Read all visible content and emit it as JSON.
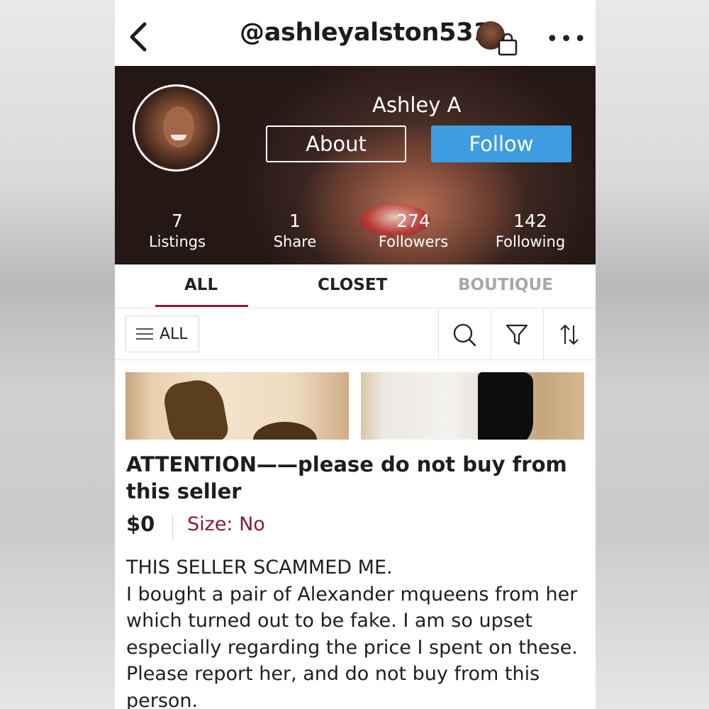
{
  "header": {
    "username": "@ashleyalston531"
  },
  "profile": {
    "display_name": "Ashley A",
    "about_label": "About",
    "follow_label": "Follow",
    "accent_color": "#3d9de0"
  },
  "stats": [
    {
      "value": "7",
      "label": "Listings"
    },
    {
      "value": "1",
      "label": "Share"
    },
    {
      "value": "274",
      "label": "Followers"
    },
    {
      "value": "142",
      "label": "Following"
    }
  ],
  "tabs": [
    {
      "label": "ALL",
      "active": true
    },
    {
      "label": "CLOSET",
      "active": false
    },
    {
      "label": "BOUTIQUE",
      "active": false
    }
  ],
  "filter": {
    "all_label": "ALL",
    "icons": [
      "search-icon",
      "filter-icon",
      "sort-icon"
    ]
  },
  "listing": {
    "title": "ATTENTION——please do not buy from this seller",
    "price": "$0",
    "size_label": "Size: No",
    "description": "THIS SELLER SCAMMED ME.\nI bought a pair of Alexander mqueens from her which turned out to be fake. I am so upset especially regarding the price I spent on these. Please report her, and do not buy from this person."
  }
}
